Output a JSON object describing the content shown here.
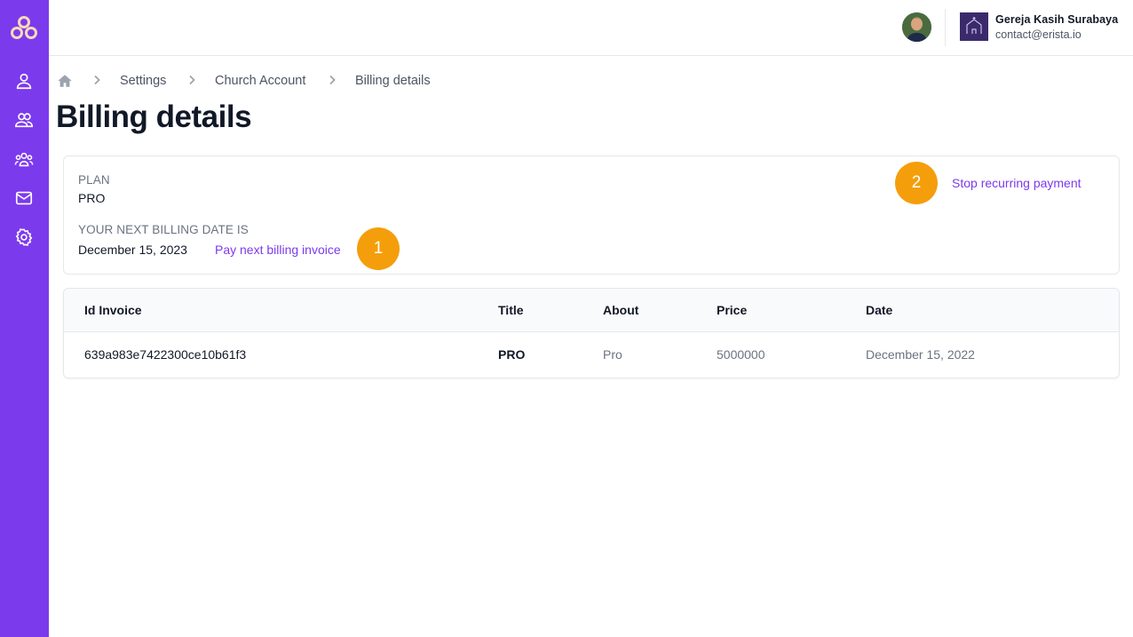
{
  "sidebar": {
    "logo": "erista-logo-icon",
    "items": [
      {
        "icon": "user-icon"
      },
      {
        "icon": "users-icon"
      },
      {
        "icon": "user-group-icon"
      },
      {
        "icon": "mail-icon"
      },
      {
        "icon": "gear-icon"
      }
    ],
    "background": "#7c3aed"
  },
  "header": {
    "church_name": "Gereja Kasih Surabaya",
    "church_email": "contact@erista.io"
  },
  "breadcrumb": {
    "items": [
      "Settings",
      "Church Account",
      "Billing details"
    ]
  },
  "page_title": "Billing details",
  "plan": {
    "plan_label": "PLAN",
    "plan_value": "PRO",
    "next_billing_label": "YOUR NEXT BILLING DATE IS",
    "next_billing_date": "December 15, 2023",
    "pay_link": "Pay next billing invoice",
    "stop_link": "Stop recurring payment",
    "marker_1": "1",
    "marker_2": "2"
  },
  "invoices": {
    "columns": [
      "Id Invoice",
      "Title",
      "About",
      "Price",
      "Date"
    ],
    "rows": [
      {
        "id": "639a983e7422300ce10b61f3",
        "title": "PRO",
        "about": "Pro",
        "price": "5000000",
        "date": "December 15, 2022"
      }
    ]
  },
  "colors": {
    "accent": "#7c3aed",
    "marker": "#f59e0b"
  }
}
